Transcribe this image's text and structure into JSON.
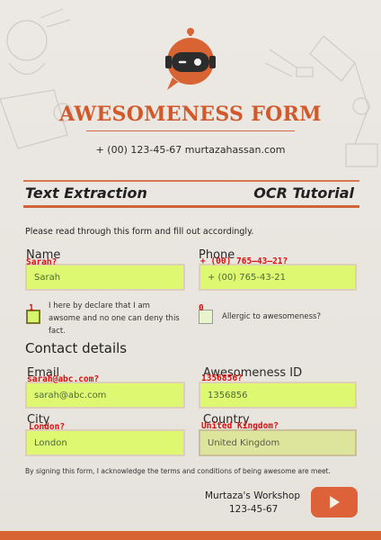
{
  "header": {
    "title": "AWESOMENESS FORM",
    "contact": "+ (00) 123-45-67 murtazahassan.com"
  },
  "subheads": {
    "left": "Text Extraction",
    "right": "OCR Tutorial"
  },
  "instructions": "Please read through this form and fill out accordingly.",
  "fields": {
    "name": {
      "label": "Name",
      "value": "Sarah",
      "overlay": "Sarah?"
    },
    "phone": {
      "label": "Phone",
      "value": "+ (00) 765-43-21",
      "overlay": "+ (00) 765—43—21?"
    },
    "email": {
      "label": "Email",
      "value": "sarah@abc.com",
      "overlay": "sarah@abc.com?"
    },
    "awesomeness_id": {
      "label": "Awesomeness ID",
      "value": "1356856",
      "overlay": "1356856?"
    },
    "city": {
      "label": "City",
      "value": "London",
      "overlay": "London?"
    },
    "country": {
      "label": "Country",
      "value": "United Kingdom",
      "overlay": "United Kingdom?"
    }
  },
  "checkboxes": {
    "declare": {
      "text": "I here by declare that I am awsome and no one can deny this fact.",
      "overlay": "1",
      "checked": true
    },
    "allergic": {
      "text": "Allergic to awesomeness?",
      "overlay": "0",
      "checked": false
    }
  },
  "section_title": "Contact details",
  "footnote": "By signing this form, I acknowledge the terms and conditions of being awesome are meet.",
  "footer": {
    "workshop": "Murtaza's Workshop",
    "phone": "123-45-67"
  },
  "colors": {
    "accent": "#d86333",
    "field_highlight": "#dff871",
    "overlay_text": "#e00d0d"
  },
  "icons": {
    "logo": "robot-chat-icon",
    "play": "play-button-icon"
  }
}
